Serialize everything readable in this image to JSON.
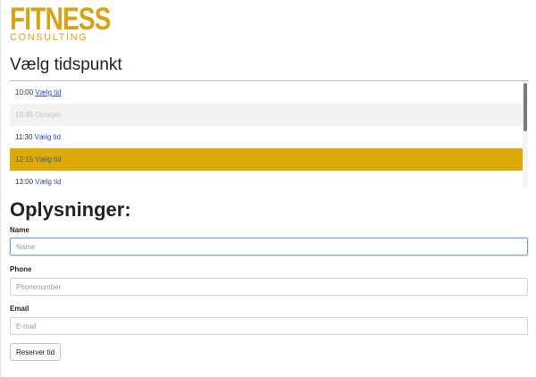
{
  "logo": {
    "main": "FITNESS",
    "sub": "CONSULTING",
    "color": "#d8a312"
  },
  "timeslots": {
    "title": "Vælg tidspunkt",
    "items": [
      {
        "time": "10:00",
        "action": "Vælg tid",
        "state": "available"
      },
      {
        "time": "10:45",
        "action": "Optaget",
        "state": "booked"
      },
      {
        "time": "11:30",
        "action": "Vælg tid",
        "state": "available"
      },
      {
        "time": "12:15",
        "action": "Vælg tid",
        "state": "selected"
      },
      {
        "time": "13:00",
        "action": "Vælg tid",
        "state": "available"
      }
    ],
    "selected_color": "#deab06"
  },
  "form": {
    "title": "Oplysninger:",
    "name": {
      "label": "Name",
      "placeholder": "Name",
      "value": ""
    },
    "phone": {
      "label": "Phone",
      "placeholder": "Phonenumber",
      "value": ""
    },
    "email": {
      "label": "Email",
      "placeholder": "E-mail",
      "value": ""
    },
    "submit_label": "Reserver tid"
  }
}
